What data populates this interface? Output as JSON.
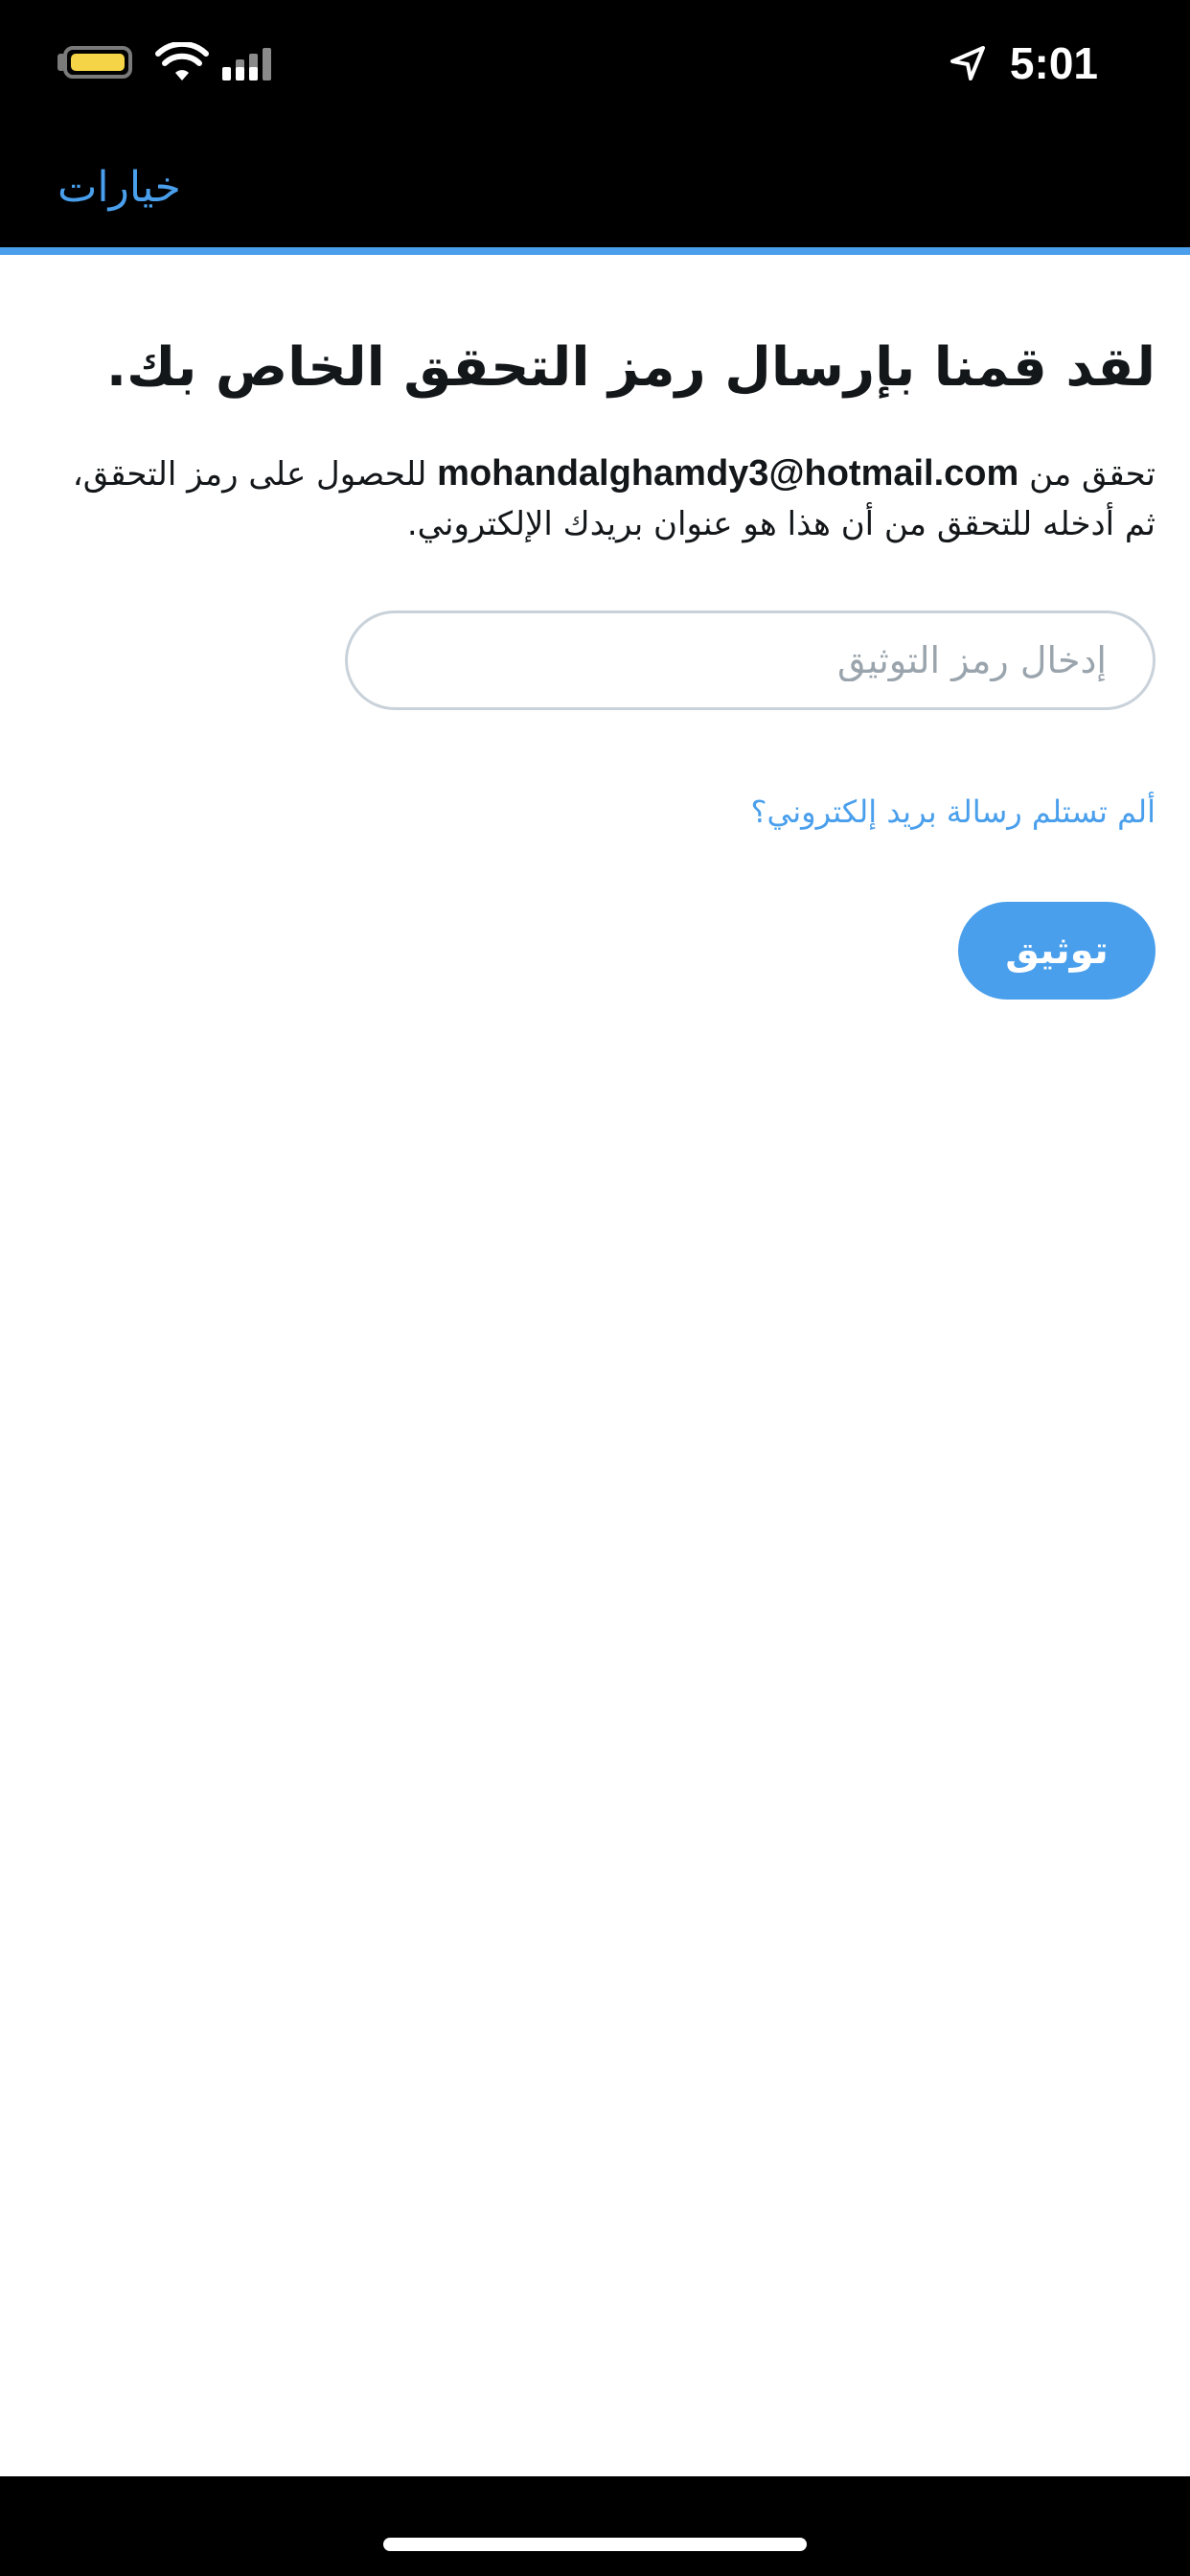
{
  "status_bar": {
    "time": "5:01",
    "battery_color": "#f5d547"
  },
  "nav": {
    "options_label": "خيارات",
    "accent_color": "#4a9fec"
  },
  "main": {
    "title": "لقد قمنا بإرسال رمز التحقق الخاص بك.",
    "description_prefix": "تحقق من ",
    "email": "mohandalghamdy3@hotmail.com",
    "description_suffix": " للحصول على رمز التحقق، ثم أدخله للتحقق من أن هذا هو عنوان بريدك الإلكتروني.",
    "code_input": {
      "placeholder": "إدخال رمز التوثيق",
      "value": ""
    },
    "resend_link": "ألم تستلم رسالة بريد إلكتروني؟",
    "verify_button": "توثيق"
  },
  "icons": {
    "battery": "battery-icon",
    "wifi": "wifi-icon",
    "cellular": "cellular-signal-icon",
    "location": "location-arrow-icon"
  }
}
